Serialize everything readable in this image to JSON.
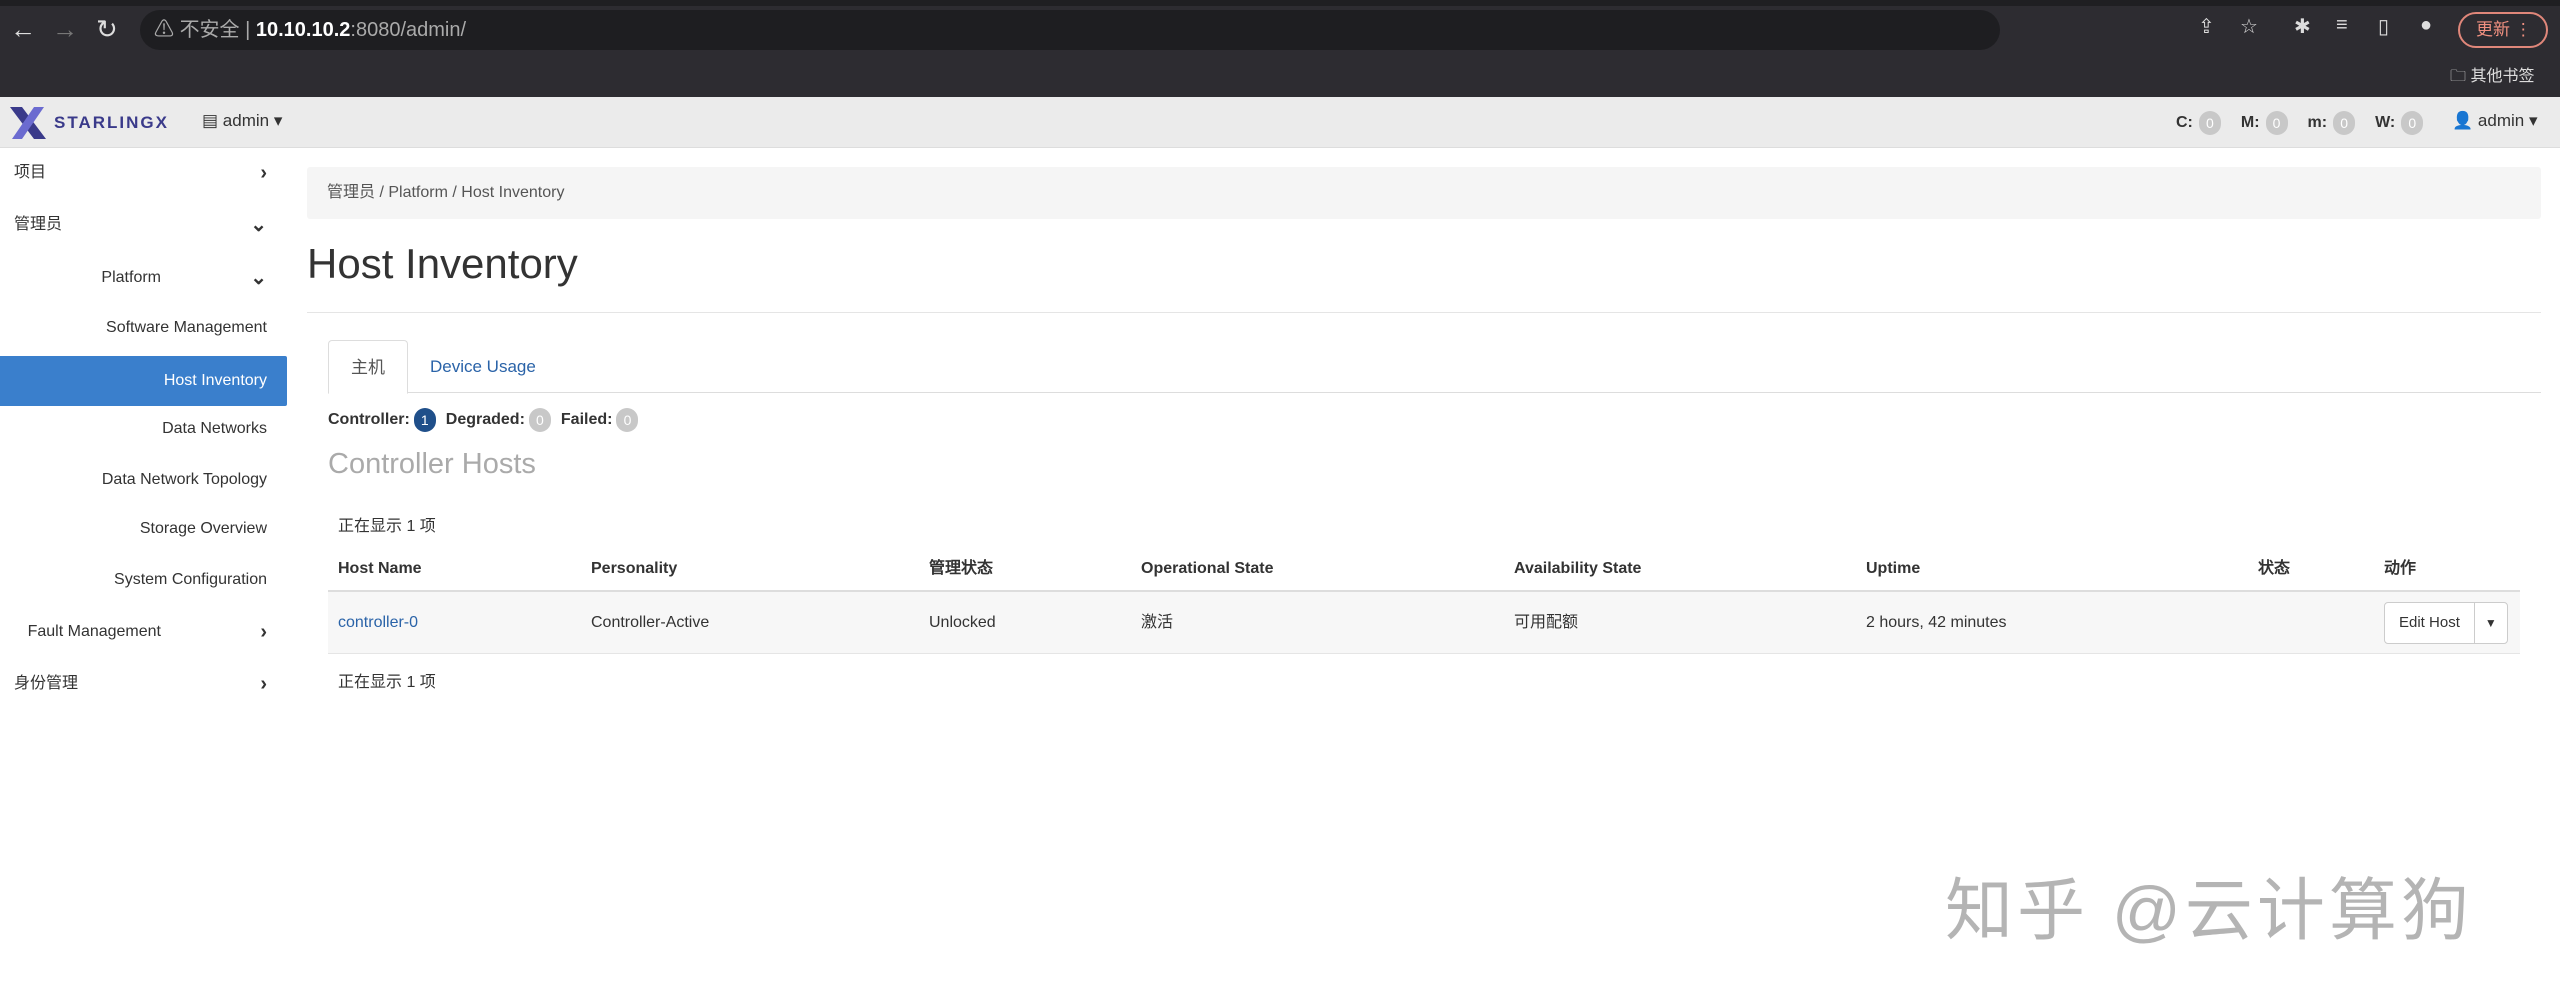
{
  "browser": {
    "security": "不安全",
    "url_host": "10.10.10.2",
    "url_rest": ":8080/admin/",
    "update_label": "更新",
    "bookmarks_label": "其他书签"
  },
  "header": {
    "brand": "STARLINGX",
    "project": "admin",
    "alarms": [
      {
        "label": "C:",
        "count": "0"
      },
      {
        "label": "M:",
        "count": "0"
      },
      {
        "label": "m:",
        "count": "0"
      },
      {
        "label": "W:",
        "count": "0"
      }
    ],
    "user": "admin"
  },
  "sidebar": {
    "items": [
      {
        "label": "项目",
        "level": "top",
        "chevron": "right"
      },
      {
        "label": "管理员",
        "level": "top",
        "chevron": "down"
      },
      {
        "label": "Platform",
        "level": "mid",
        "chevron": "down"
      },
      {
        "label": "Software Management",
        "level": "leaf"
      },
      {
        "label": "Host Inventory",
        "level": "leaf",
        "active": true
      },
      {
        "label": "Data Networks",
        "level": "leaf"
      },
      {
        "label": "Data Network Topology",
        "level": "leaf"
      },
      {
        "label": "Storage Overview",
        "level": "leaf"
      },
      {
        "label": "System Configuration",
        "level": "leaf"
      },
      {
        "label": "Fault Management",
        "level": "mid",
        "chevron": "right"
      },
      {
        "label": "身份管理",
        "level": "top",
        "chevron": "right"
      }
    ]
  },
  "breadcrumb": [
    "管理员",
    "Platform",
    "Host Inventory"
  ],
  "page_title": "Host Inventory",
  "tabs": [
    {
      "label": "主机",
      "active": true
    },
    {
      "label": "Device Usage"
    }
  ],
  "summary": {
    "controller_label": "Controller:",
    "controller": "1",
    "degraded_label": "Degraded:",
    "degraded": "0",
    "failed_label": "Failed:",
    "failed": "0"
  },
  "section_title": "Controller Hosts",
  "count_text": "正在显示 1 项",
  "table": {
    "columns": [
      "Host Name",
      "Personality",
      "管理状态",
      "Operational State",
      "Availability State",
      "Uptime",
      "状态",
      "动作"
    ],
    "rows": [
      [
        "controller-0",
        "Controller-Active",
        "Unlocked",
        "激活",
        "可用配额",
        "2 hours, 42 minutes",
        ""
      ]
    ],
    "action_label": "Edit Host"
  },
  "watermark": "知乎 @云计算狗",
  "colors": {
    "accent": "#3a7fcc",
    "link": "#2a63a8",
    "badge_active": "#1f4f8a"
  }
}
